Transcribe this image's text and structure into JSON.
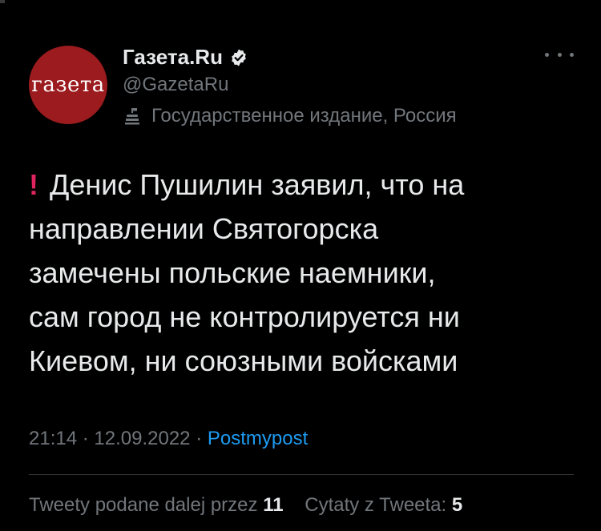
{
  "author": {
    "avatar_text": "газета",
    "display_name": "Газета.Ru",
    "handle": "@GazetaRu",
    "affiliation": "Государственное издание, Россия"
  },
  "tweet": {
    "text_lines": [
      "Денис Пушилин заявил, что на",
      "направлении Святогорска",
      "замечены польские наемники,",
      "сам город не контролируется ни",
      "Киевом, ни союзными войсками"
    ],
    "time": "21:14",
    "separator": "·",
    "date": "12.09.2022",
    "source": "Postmypost"
  },
  "stats": {
    "retweets_label": "Tweety podane dalej przez",
    "retweets_count": "11",
    "quotes_label": "Cytaty z Tweeta:",
    "quotes_count": "5"
  },
  "colors": {
    "background": "#000000",
    "text": "#e7e9ea",
    "muted": "#71767b",
    "link": "#1d9bf0",
    "avatar_bg": "#9b1b1e",
    "exclamation": "#e0245e"
  },
  "icons": {
    "verified": "verified-badge-icon",
    "affiliation": "government-building-icon",
    "exclamation": "red-exclamation-icon",
    "more": "more-options-icon"
  }
}
